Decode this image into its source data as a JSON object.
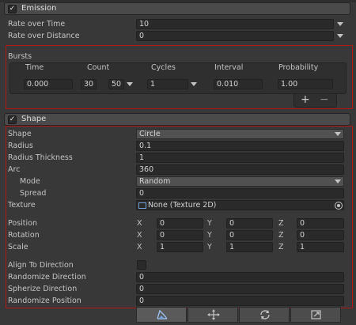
{
  "emission": {
    "title": "Emission",
    "rate_over_time_label": "Rate over Time",
    "rate_over_time_value": "10",
    "rate_over_distance_label": "Rate over Distance",
    "rate_over_distance_value": "0"
  },
  "bursts": {
    "title": "Bursts",
    "columns": [
      "Time",
      "Count",
      "Cycles",
      "Interval",
      "Probability"
    ],
    "row": {
      "time": "0.000",
      "count_min": "30",
      "count_max": "50",
      "cycles": "1",
      "interval": "0.010",
      "probability": "1.00"
    },
    "add_label": "+",
    "remove_label": "−"
  },
  "shape": {
    "title": "Shape",
    "shape_label": "Shape",
    "shape_value": "Circle",
    "radius_label": "Radius",
    "radius_value": "0.1",
    "radius_thickness_label": "Radius Thickness",
    "radius_thickness_value": "1",
    "arc_label": "Arc",
    "arc_value": "360",
    "mode_label": "Mode",
    "mode_value": "Random",
    "spread_label": "Spread",
    "spread_value": "0",
    "texture_label": "Texture",
    "texture_value": "None (Texture 2D)",
    "position_label": "Position",
    "position": {
      "x": "0",
      "y": "0",
      "z": "0"
    },
    "rotation_label": "Rotation",
    "rotation": {
      "x": "0",
      "y": "0",
      "z": "0"
    },
    "scale_label": "Scale",
    "scale": {
      "x": "1",
      "y": "1",
      "z": "1"
    },
    "axis_labels": {
      "x": "X",
      "y": "Y",
      "z": "Z"
    },
    "align_label": "Align To Direction",
    "randomize_direction_label": "Randomize Direction",
    "randomize_direction_value": "0",
    "spherize_direction_label": "Spherize Direction",
    "spherize_direction_value": "0",
    "randomize_position_label": "Randomize Position",
    "randomize_position_value": "0"
  },
  "toolbar": {
    "icons": [
      "edit-shape-icon",
      "move-icon",
      "rotate-icon",
      "scale-icon"
    ]
  },
  "colors": {
    "background": "#383838",
    "highlight_border": "#b01818"
  }
}
